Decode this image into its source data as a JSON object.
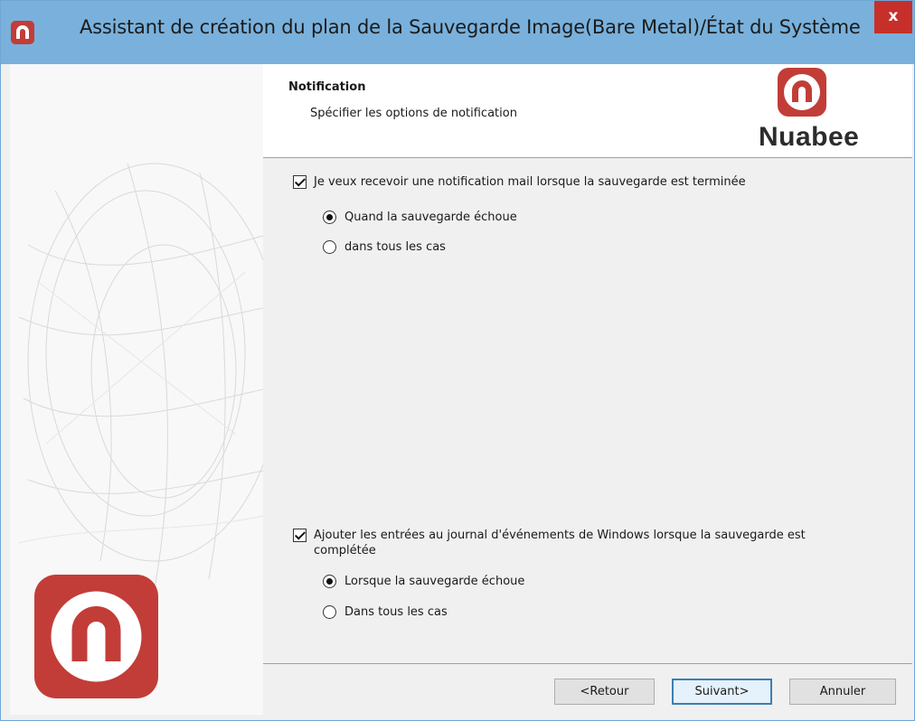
{
  "window": {
    "title": "Assistant de création du plan de la Sauvegarde Image(Bare Metal)/État du Système",
    "close_label": "x"
  },
  "header": {
    "title": "Notification",
    "subtitle": "Spécifier les options de notification",
    "brand": "Nuabee"
  },
  "options": {
    "mail": {
      "label": "Je veux recevoir une notification mail lorsque la sauvegarde est terminée",
      "checked": true,
      "radios": [
        {
          "label": "Quand la sauvegarde échoue",
          "selected": true
        },
        {
          "label": "dans tous les cas",
          "selected": false
        }
      ]
    },
    "eventlog": {
      "label": "Ajouter les entrées au journal d'événements de Windows lorsque la sauvegarde est complétée",
      "checked": true,
      "radios": [
        {
          "label": "Lorsque la sauvegarde échoue",
          "selected": true
        },
        {
          "label": "Dans tous les cas",
          "selected": false
        }
      ]
    }
  },
  "buttons": {
    "back": "<Retour",
    "next": "Suivant>",
    "cancel": "Annuler"
  },
  "colors": {
    "titlebar": "#79b1dc",
    "brand_red": "#c23d38",
    "close_red": "#c7302a"
  }
}
